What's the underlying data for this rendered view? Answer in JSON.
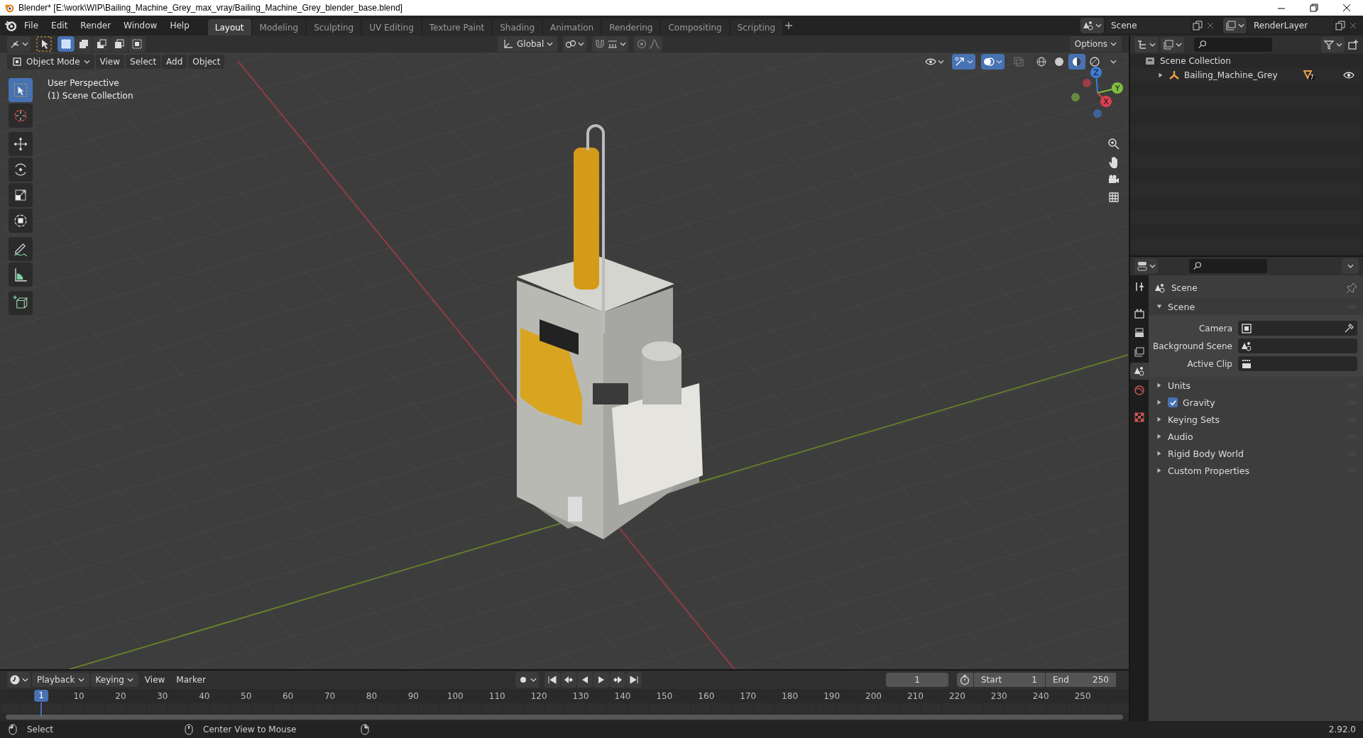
{
  "title_bar": {
    "title": "Blender* [E:\\work\\WIP\\Bailing_Machine_Grey_max_vray/Bailing_Machine_Grey_blender_base.blend]"
  },
  "top_bar": {
    "menus": [
      "File",
      "Edit",
      "Render",
      "Window",
      "Help"
    ],
    "workspaces": [
      {
        "label": "Layout",
        "selected": true
      },
      {
        "label": "Modeling",
        "selected": false
      },
      {
        "label": "Sculpting",
        "selected": false
      },
      {
        "label": "UV Editing",
        "selected": false
      },
      {
        "label": "Texture Paint",
        "selected": false
      },
      {
        "label": "Shading",
        "selected": false
      },
      {
        "label": "Animation",
        "selected": false
      },
      {
        "label": "Rendering",
        "selected": false
      },
      {
        "label": "Compositing",
        "selected": false
      },
      {
        "label": "Scripting",
        "selected": false
      }
    ],
    "scene": "Scene",
    "view_layer": "RenderLayer"
  },
  "tool_header": {
    "select_modes": [
      {
        "kind": "set",
        "selected": true
      },
      {
        "kind": "extend",
        "selected": false
      },
      {
        "kind": "subtract",
        "selected": false
      },
      {
        "kind": "invert",
        "selected": false
      },
      {
        "kind": "intersect",
        "selected": false
      }
    ],
    "orientation": "Global",
    "options": "Options"
  },
  "viewport_header": {
    "mode": "Object Mode",
    "menus": [
      "View",
      "Select",
      "Add",
      "Object"
    ],
    "toggles": [
      {
        "kind": "gizmos",
        "on": true
      },
      {
        "kind": "overlays",
        "on": true
      },
      {
        "kind": "xray",
        "on": false
      }
    ],
    "shading": [
      {
        "kind": "wireframe",
        "selected": false
      },
      {
        "kind": "solid",
        "selected": false
      },
      {
        "kind": "material",
        "selected": true
      },
      {
        "kind": "rendered",
        "selected": false
      }
    ]
  },
  "viewport": {
    "info": [
      "User Perspective",
      "(1) Scene Collection"
    ],
    "tool_groups": [
      [
        {
          "kind": "select",
          "selected": true
        },
        {
          "kind": "cursor",
          "selected": false
        }
      ],
      [
        {
          "kind": "move",
          "selected": false
        },
        {
          "kind": "rotate",
          "selected": false
        },
        {
          "kind": "scale",
          "selected": false
        },
        {
          "kind": "transform",
          "selected": false
        }
      ],
      [
        {
          "kind": "annotate",
          "selected": false
        },
        {
          "kind": "measure",
          "selected": false
        }
      ],
      [
        {
          "kind": "add_cube",
          "selected": false
        }
      ]
    ],
    "axes": [
      {
        "kind": "z",
        "label": "Z"
      },
      {
        "kind": "y",
        "label": "Y"
      },
      {
        "kind": "x",
        "label": "X"
      }
    ]
  },
  "timeline": {
    "menus": [
      {
        "label": "Playback",
        "dropdown": true
      },
      {
        "label": "Keying",
        "dropdown": true
      },
      {
        "label": "View",
        "dropdown": false
      },
      {
        "label": "Marker",
        "dropdown": false
      }
    ],
    "current_frame": "1",
    "start_label": "Start",
    "start": "1",
    "end_label": "End",
    "end": "250",
    "playhead": "1",
    "frame_labels": [
      "10",
      "20",
      "30",
      "40",
      "50",
      "60",
      "70",
      "80",
      "90",
      "100",
      "110",
      "120",
      "130",
      "140",
      "150",
      "160",
      "170",
      "180",
      "190",
      "200",
      "210",
      "220",
      "230",
      "240",
      "250"
    ]
  },
  "outliner": {
    "root": "Scene Collection",
    "items": [
      {
        "label": "Bailing_Machine_Grey",
        "expanded": false,
        "badge": "7",
        "visible": true
      }
    ]
  },
  "properties": {
    "tabs": [
      {
        "kind": "tool",
        "selected": false
      },
      {
        "kind": "render",
        "selected": false
      },
      {
        "kind": "output",
        "selected": false
      },
      {
        "kind": "view_layer",
        "selected": false
      },
      {
        "kind": "scene",
        "selected": true
      },
      {
        "kind": "world",
        "selected": false
      },
      {
        "kind": "texture",
        "selected": false
      }
    ],
    "context": "Scene",
    "panels": [
      {
        "label": "Scene",
        "kind": "plain",
        "expanded": true,
        "fields": [
          {
            "label": "Camera",
            "kind": "camera"
          },
          {
            "label": "Background Scene",
            "kind": "scene"
          },
          {
            "label": "Active Clip",
            "kind": "clip"
          }
        ]
      },
      {
        "label": "Units",
        "kind": "plain",
        "expanded": false
      },
      {
        "label": "Gravity",
        "kind": "checkbox",
        "checked": true,
        "expanded": false
      },
      {
        "label": "Keying Sets",
        "kind": "plain",
        "expanded": false
      },
      {
        "label": "Audio",
        "kind": "plain",
        "expanded": false
      },
      {
        "label": "Rigid Body World",
        "kind": "plain",
        "expanded": false
      },
      {
        "label": "Custom Properties",
        "kind": "plain",
        "expanded": false
      }
    ]
  },
  "status_bar": {
    "hints": [
      {
        "kind": "left",
        "label": "Select"
      },
      {
        "kind": "middle",
        "label": "Center View to Mouse"
      },
      {
        "kind": "right"
      }
    ],
    "version": "2.92.0"
  }
}
